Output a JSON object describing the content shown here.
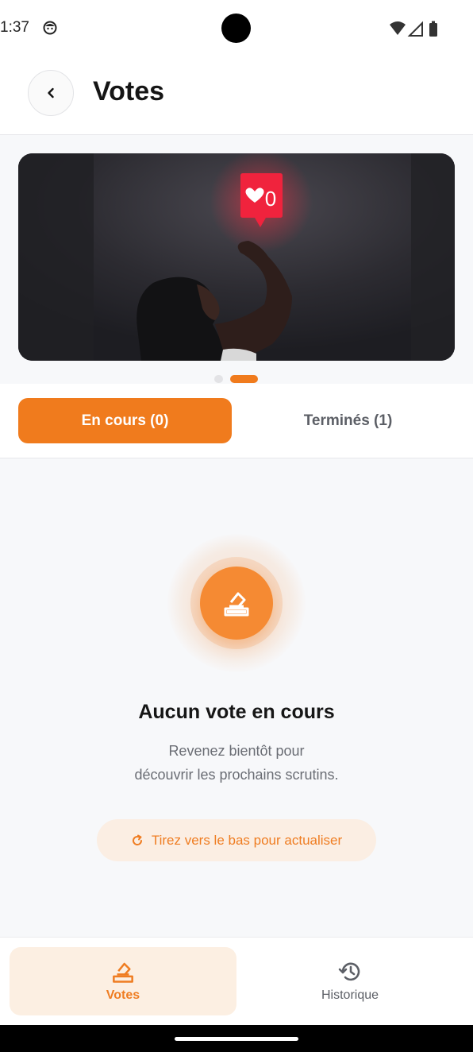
{
  "status_bar": {
    "time": "1:37"
  },
  "app_bar": {
    "title": "Votes",
    "back_icon": "chevron-left-icon"
  },
  "banner": {
    "badge_count": "0",
    "slides_total": 2,
    "active_slide": 2
  },
  "tabs": [
    {
      "label": "En cours (0)",
      "active": true
    },
    {
      "label": "Terminés (1)",
      "active": false
    }
  ],
  "empty_state": {
    "icon": "ballot-box-icon",
    "title": "Aucun vote en cours",
    "description_line1": "Revenez bientôt pour",
    "description_line2": "découvrir les prochains scrutins.",
    "refresh_label": "Tirez vers le bas pour actualiser"
  },
  "bottom_nav": [
    {
      "label": "Votes",
      "icon": "ballot-box-icon",
      "active": true
    },
    {
      "label": "Historique",
      "icon": "history-icon",
      "active": false
    }
  ],
  "colors": {
    "accent": "#f07b1d",
    "accent_soft": "#fcefe2",
    "background": "#f7f8fa"
  }
}
